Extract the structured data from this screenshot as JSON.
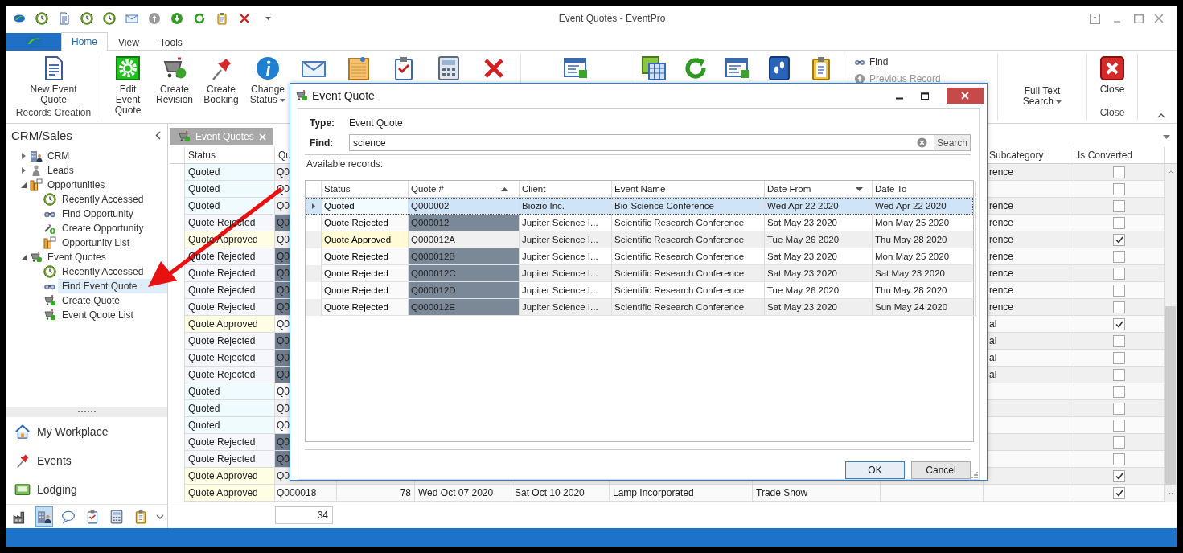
{
  "window": {
    "title": "Event Quotes - EventPro"
  },
  "ribbon_tabs": [
    {
      "label": "Home",
      "selected": true
    },
    {
      "label": "View",
      "selected": false
    },
    {
      "label": "Tools",
      "selected": false
    }
  ],
  "ribbon": {
    "new_group": {
      "label": "Records Creation",
      "buttons": [
        {
          "label": "New Event Quote"
        }
      ]
    },
    "edit_buttons": [
      {
        "label": "Edit Event Quote",
        "dropdown": false
      },
      {
        "label": "Create Revision",
        "dropdown": false
      },
      {
        "label": "Create Booking",
        "dropdown": false
      },
      {
        "label": "Change Status",
        "dropdown": true
      }
    ],
    "nav_buttons": [
      {
        "label": "Find",
        "disabled": false
      },
      {
        "label": "Previous Record",
        "disabled": true
      }
    ],
    "search_button": {
      "label": "Full Text Search",
      "dropdown": true
    },
    "close_group": {
      "label": "Close",
      "buttons": [
        {
          "label": "Close"
        }
      ]
    }
  },
  "sidebar": {
    "title": "CRM/Sales",
    "tree": [
      {
        "label": "CRM",
        "expanded": false
      },
      {
        "label": "Leads",
        "expanded": false
      },
      {
        "label": "Opportunities",
        "expanded": true,
        "children": [
          {
            "label": "Recently Accessed",
            "selected": false
          },
          {
            "label": "Find Opportunity",
            "selected": false
          },
          {
            "label": "Create Opportunity",
            "selected": false
          },
          {
            "label": "Opportunity List",
            "selected": false
          }
        ]
      },
      {
        "label": "Event Quotes",
        "expanded": true,
        "children": [
          {
            "label": "Recently Accessed",
            "selected": false
          },
          {
            "label": "Find Event Quote",
            "selected": true
          },
          {
            "label": "Create Quote",
            "selected": false
          },
          {
            "label": "Event Quote List",
            "selected": false
          }
        ]
      }
    ],
    "nav": [
      {
        "label": "My Workplace"
      },
      {
        "label": "Events"
      },
      {
        "label": "Lodging"
      }
    ],
    "shortcuts": [
      {
        "selected": false
      },
      {
        "selected": true
      },
      {
        "selected": false
      },
      {
        "selected": false
      },
      {
        "selected": false
      },
      {
        "selected": false
      }
    ]
  },
  "document_tabs": [
    {
      "label": "Event Quotes",
      "selected": true
    }
  ],
  "grid": {
    "columns": {
      "status": "Status",
      "quote": "Qu",
      "subcategory": "Subcategory",
      "converted": "Is Converted"
    },
    "rows": [
      {
        "kind": "quoted",
        "status": "Quoted",
        "quote": "Q0",
        "subcategory": "rence",
        "converted": false
      },
      {
        "kind": "quoted",
        "status": "Quoted",
        "quote": "Q0",
        "converted": false
      },
      {
        "kind": "quoted",
        "status": "Quoted",
        "quote": "Q0",
        "subcategory": "rence",
        "converted": false
      },
      {
        "kind": "rejected",
        "status": "Quote Rejected",
        "quote": "Q0",
        "subcategory": "rence",
        "converted": false
      },
      {
        "kind": "approved",
        "status": "Quote Approved",
        "quote": "Q0",
        "subcategory": "rence",
        "converted": true
      },
      {
        "kind": "rejected",
        "status": "Quote Rejected",
        "quote": "Q0",
        "subcategory": "rence",
        "converted": false
      },
      {
        "kind": "rejected",
        "status": "Quote Rejected",
        "quote": "Q0",
        "subcategory": "rence",
        "converted": false
      },
      {
        "kind": "rejected",
        "status": "Quote Rejected",
        "quote": "Q0",
        "subcategory": "rence",
        "converted": false
      },
      {
        "kind": "rejected",
        "status": "Quote Rejected",
        "quote": "Q0",
        "subcategory": "rence",
        "converted": false
      },
      {
        "kind": "approved",
        "status": "Quote Approved",
        "quote": "Q0",
        "subcategory": "al",
        "converted": true
      },
      {
        "kind": "rejected",
        "status": "Quote Rejected",
        "quote": "Q0",
        "subcategory": "al",
        "converted": false
      },
      {
        "kind": "rejected",
        "status": "Quote Rejected",
        "quote": "Q0",
        "subcategory": "al",
        "converted": false
      },
      {
        "kind": "rejected",
        "status": "Quote Rejected",
        "quote": "Q0",
        "subcategory": "al",
        "converted": false
      },
      {
        "kind": "quoted",
        "status": "Quoted",
        "quote": "Q0",
        "converted": false
      },
      {
        "kind": "quoted",
        "status": "Quoted",
        "quote": "Q0",
        "converted": false
      },
      {
        "kind": "quoted",
        "status": "Quoted",
        "quote": "Q0",
        "converted": false
      },
      {
        "kind": "rejected",
        "status": "Quote Rejected",
        "quote": "Q0",
        "converted": false
      },
      {
        "kind": "rejected",
        "status": "Quote Rejected",
        "quote": "Q0",
        "converted": false
      },
      {
        "kind": "approved",
        "status": "Quote Approved",
        "quote": "Q0",
        "converted": true
      },
      {
        "kind": "approved",
        "status": "Quote Approved",
        "quote": "Q000018",
        "cells": [
          "78",
          "Wed Oct 07 2020",
          "Sat Oct 10 2020",
          "Lamp Incorporated",
          "Trade Show"
        ],
        "converted": true
      }
    ],
    "total": "34"
  },
  "dialog": {
    "title": "Event Quote",
    "type_label": "Type:",
    "type_value": "Event Quote",
    "find_label": "Find:",
    "find_value": "science",
    "search_button": "Search",
    "records_label": "Available records:",
    "columns": [
      {
        "label": "Status"
      },
      {
        "label": "Quote #",
        "sort_asc": true
      },
      {
        "label": "Client"
      },
      {
        "label": "Event Name"
      },
      {
        "label": "Date From",
        "sort_desc": true
      },
      {
        "label": "Date To"
      }
    ],
    "rows": [
      {
        "kind": "quoted",
        "selected": true,
        "cells": [
          "Quoted",
          "Q000002",
          "Biozio Inc.",
          "Bio-Science Conference",
          "Wed Apr 22 2020",
          "Wed Apr 22 2020"
        ]
      },
      {
        "kind": "rejected",
        "selected": false,
        "cells": [
          "Quote Rejected",
          "Q000012",
          "Jupiter Science I...",
          "Scientific Research Conference",
          "Sat May 23 2020",
          "Mon May 25 2020"
        ]
      },
      {
        "kind": "approved",
        "selected": false,
        "cells": [
          "Quote Approved",
          "Q000012A",
          "Jupiter Science I...",
          "Scientific Research Conference",
          "Tue May 26 2020",
          "Thu May 28 2020"
        ]
      },
      {
        "kind": "rejected",
        "selected": false,
        "cells": [
          "Quote Rejected",
          "Q000012B",
          "Jupiter Science I...",
          "Scientific Research Conference",
          "Sat May 23 2020",
          "Mon May 25 2020"
        ]
      },
      {
        "kind": "rejected",
        "selected": false,
        "cells": [
          "Quote Rejected",
          "Q000012C",
          "Jupiter Science I...",
          "Scientific Research Conference",
          "Sat May 23 2020",
          "Sat May 23 2020"
        ]
      },
      {
        "kind": "rejected",
        "selected": false,
        "cells": [
          "Quote Rejected",
          "Q000012D",
          "Jupiter Science I...",
          "Scientific Research Conference",
          "Tue May 26 2020",
          "Thu May 28 2020"
        ]
      },
      {
        "kind": "rejected",
        "selected": false,
        "cells": [
          "Quote Rejected",
          "Q000012E",
          "Jupiter Science I...",
          "Scientific Research Conference",
          "Sat May 23 2020",
          "Sun May 24 2020"
        ]
      }
    ],
    "buttons": [
      "OK",
      "Cancel"
    ]
  }
}
